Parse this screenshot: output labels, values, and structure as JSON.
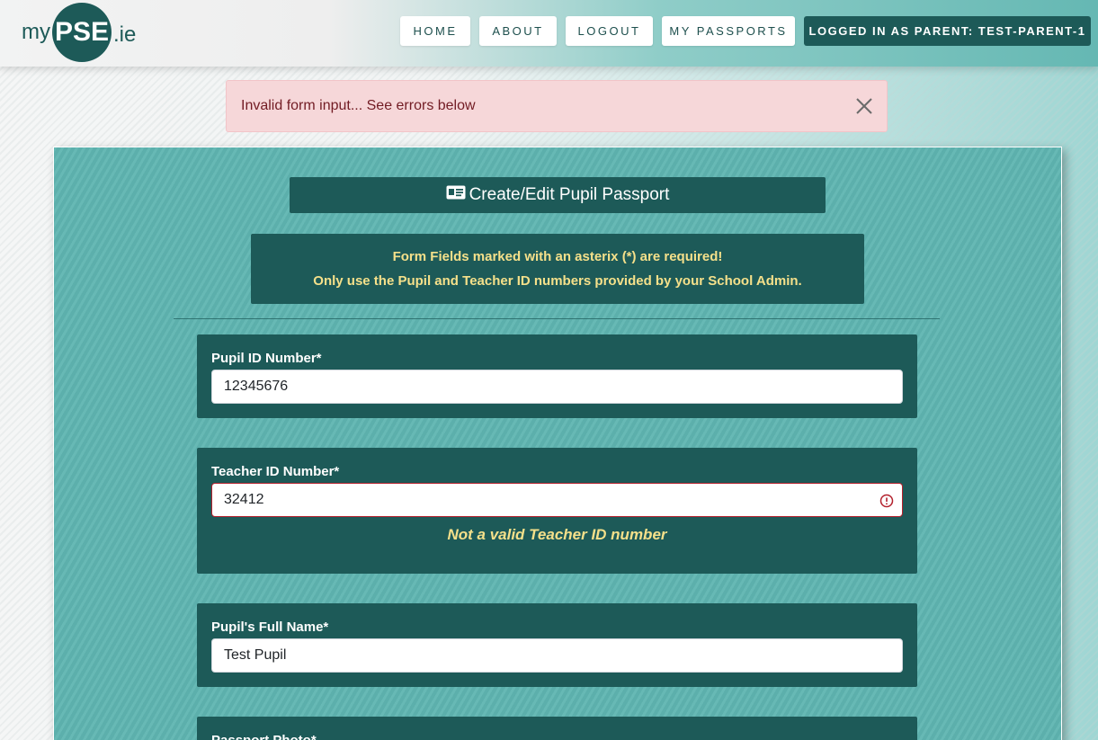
{
  "brand": {
    "my": "my",
    "pse": "PSE",
    "ie": ".ie"
  },
  "nav": {
    "items": [
      {
        "label": "HOME"
      },
      {
        "label": "ABOUT"
      },
      {
        "label": "LOGOUT"
      },
      {
        "label": "MY PASSPORTS"
      }
    ],
    "user_label": "LOGGED IN AS PARENT: TEST-PARENT-1"
  },
  "alert": {
    "message": "Invalid form input... See errors below",
    "close_icon": "close-icon"
  },
  "form": {
    "title": "Create/Edit Pupil Passport",
    "title_icon": "id-card-icon",
    "info_line1": "Form Fields marked with an asterix (*) are required!",
    "info_line2": "Only use the Pupil and Teacher ID numbers provided by your School Admin.",
    "fields": [
      {
        "label": "Pupil ID Number*",
        "value": "12345676"
      },
      {
        "label": "Teacher ID Number*",
        "value": "32412",
        "error": "Not a valid Teacher ID number"
      },
      {
        "label": "Pupil's Full Name*",
        "value": "Test Pupil"
      },
      {
        "label": "Passport Photo*"
      }
    ]
  },
  "colors": {
    "primary": "#1d5a58",
    "panel": "#5fb5b1",
    "highlight_text": "#f5e08a",
    "alert_bg": "#f6d7d9",
    "error": "#b3202c"
  }
}
